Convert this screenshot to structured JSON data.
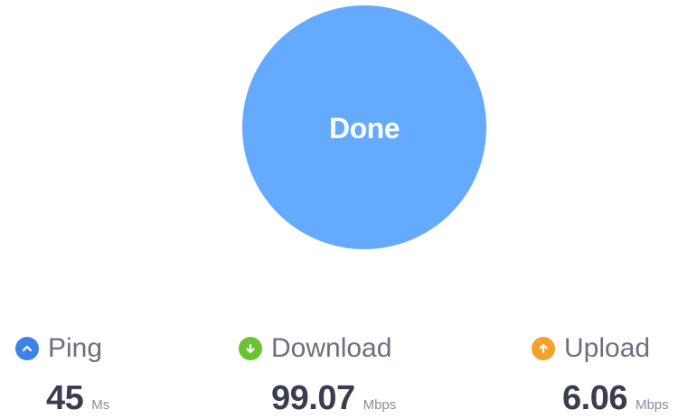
{
  "status": {
    "button_label": "Done",
    "circle_color": "#64aaff"
  },
  "metrics": {
    "ping": {
      "label": "Ping",
      "value": "45",
      "unit": "Ms",
      "icon": "chevron-up-icon",
      "color": "#3e82e6"
    },
    "download": {
      "label": "Download",
      "value": "99.07",
      "unit": "Mbps",
      "icon": "arrow-down-icon",
      "color": "#6cc331"
    },
    "upload": {
      "label": "Upload",
      "value": "6.06",
      "unit": "Mbps",
      "icon": "arrow-up-icon",
      "color": "#f5a02a"
    }
  }
}
